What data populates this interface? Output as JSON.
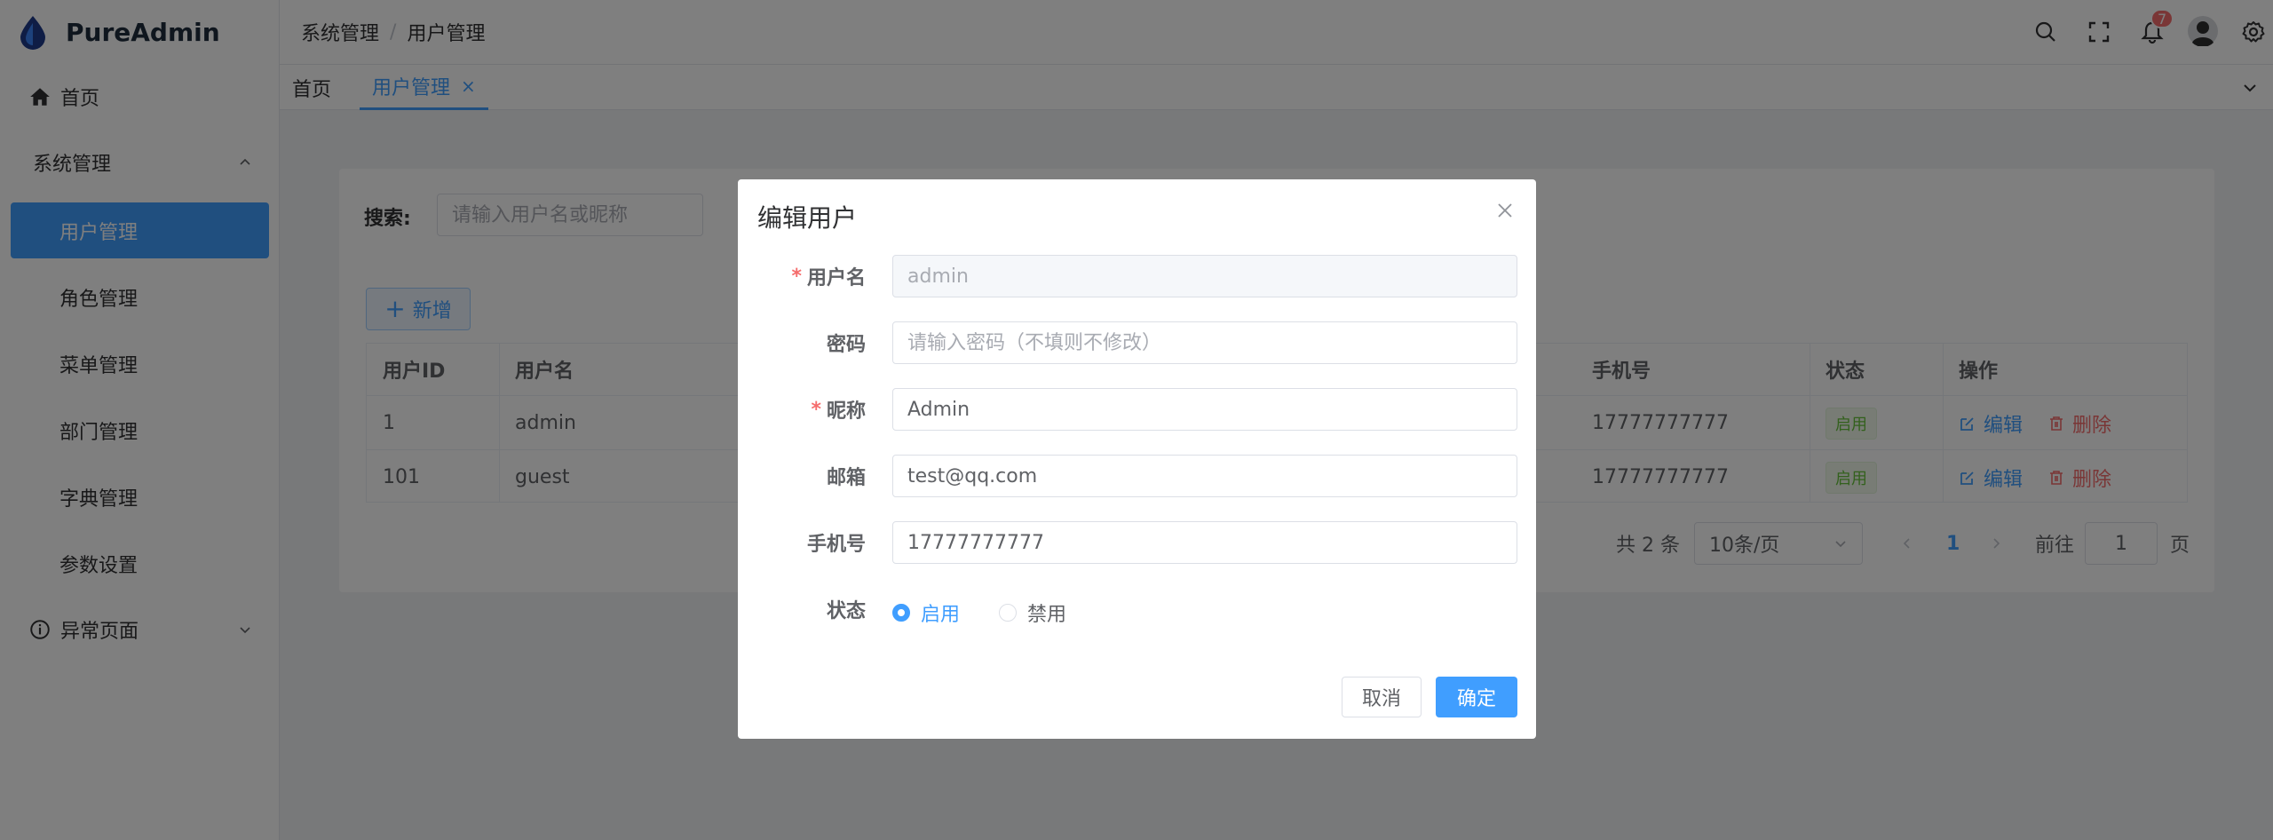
{
  "app": {
    "title": "PureAdmin"
  },
  "sidebar": {
    "items": [
      {
        "label": "首页",
        "icon": "home-icon"
      },
      {
        "label": "系统管理"
      },
      {
        "label": "异常页面",
        "icon": "info-icon"
      }
    ],
    "submenu": [
      {
        "label": "用户管理",
        "active": true
      },
      {
        "label": "角色管理"
      },
      {
        "label": "菜单管理"
      },
      {
        "label": "部门管理"
      },
      {
        "label": "字典管理"
      },
      {
        "label": "参数设置"
      }
    ]
  },
  "navbar": {
    "breadcrumb": [
      "系统管理",
      "用户管理"
    ],
    "separator": "/",
    "notification_count": "7"
  },
  "tags": [
    {
      "label": "首页"
    },
    {
      "label": "用户管理",
      "active": true,
      "close": "×"
    }
  ],
  "search": {
    "label": "搜索:",
    "placeholder": "请输入用户名或昵称"
  },
  "add_button": {
    "label": "新增"
  },
  "table": {
    "columns": [
      "用户ID",
      "用户名",
      "手机号",
      "状态",
      "操作"
    ],
    "rows": [
      {
        "id": "1",
        "username": "admin",
        "phone": "17777777777",
        "status": "启用"
      },
      {
        "id": "101",
        "username": "guest",
        "phone": "17777777777",
        "status": "启用"
      }
    ],
    "actions": {
      "edit": "编辑",
      "delete": "删除"
    }
  },
  "pagination": {
    "total": "共 2 条",
    "page_size": "10条/页",
    "current": "1",
    "goto_prefix": "前往",
    "goto_value": "1",
    "goto_suffix": "页"
  },
  "dialog": {
    "title": "编辑用户",
    "fields": {
      "username": {
        "label": "用户名",
        "value": "admin",
        "required": true
      },
      "password": {
        "label": "密码",
        "placeholder": "请输入密码（不填则不修改）"
      },
      "nickname": {
        "label": "昵称",
        "value": "Admin",
        "required": true
      },
      "email": {
        "label": "邮箱",
        "value": "test@qq.com"
      },
      "phone": {
        "label": "手机号",
        "value": "17777777777"
      },
      "status": {
        "label": "状态",
        "options": [
          "启用",
          "禁用"
        ],
        "selected": "启用"
      }
    },
    "cancel": "取消",
    "confirm": "确定",
    "required_mark": "*"
  },
  "colors": {
    "primary": "#409eff",
    "success": "#67c23a",
    "danger": "#f56c6c"
  }
}
